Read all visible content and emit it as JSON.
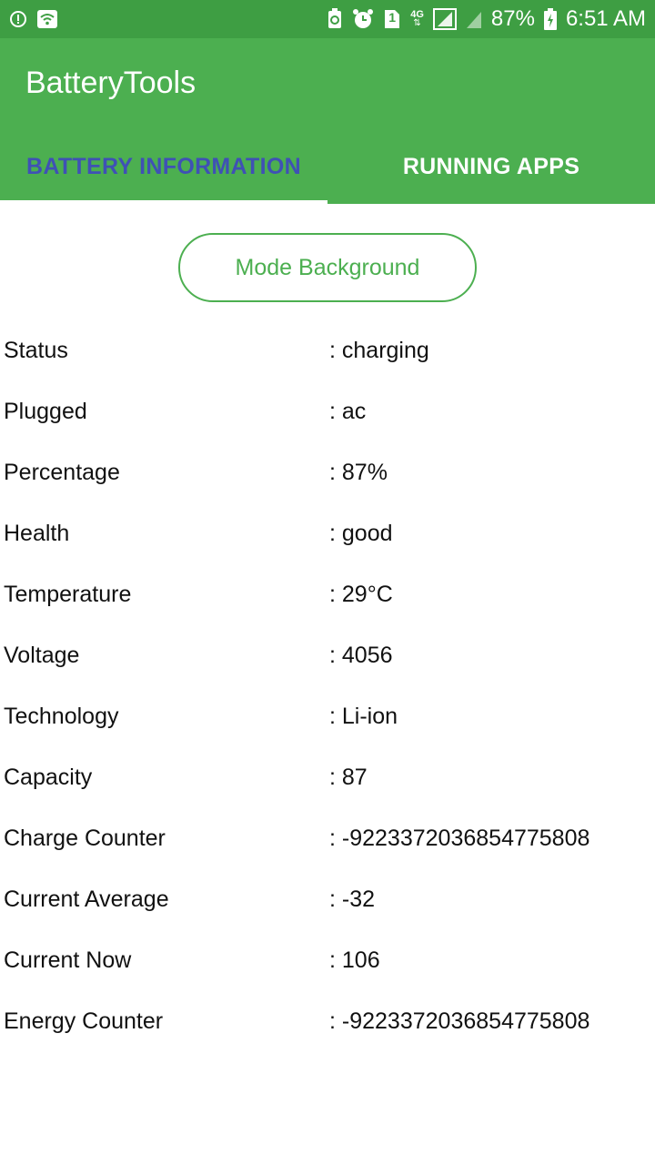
{
  "status_bar": {
    "battery_percent": "87%",
    "time": "6:51 AM",
    "network": "4G",
    "sim_slot": "1",
    "icons": [
      "alert-icon",
      "wifi-icon",
      "recycle-icon",
      "alarm-icon",
      "sim-icon",
      "network-4g-icon",
      "signal-icon",
      "signal-icon",
      "battery-charging-icon"
    ]
  },
  "app": {
    "title": "BatteryTools"
  },
  "tabs": [
    {
      "label": "BATTERY INFORMATION",
      "selected": true
    },
    {
      "label": "RUNNING APPS",
      "selected": false
    }
  ],
  "mode_button": {
    "label": "Mode Background"
  },
  "battery_info": [
    {
      "label": "Status",
      "value": ": charging"
    },
    {
      "label": "Plugged",
      "value": ": ac"
    },
    {
      "label": "Percentage",
      "value": ": 87%"
    },
    {
      "label": "Health",
      "value": ": good"
    },
    {
      "label": "Temperature",
      "value": ": 29°C"
    },
    {
      "label": "Voltage",
      "value": ": 4056"
    },
    {
      "label": "Technology",
      "value": ": Li-ion"
    },
    {
      "label": "Capacity",
      "value": ": 87"
    },
    {
      "label": "Charge Counter",
      "value": ": -9223372036854775808"
    },
    {
      "label": "Current Average",
      "value": ": -32"
    },
    {
      "label": "Current Now",
      "value": ": 106"
    },
    {
      "label": "Energy Counter",
      "value": ": -9223372036854775808"
    }
  ],
  "colors": {
    "status_bar": "#3e9e43",
    "primary": "#4caf50",
    "tab_selected_text": "#3f51b5",
    "tab_unselected_text": "#ffffff"
  }
}
